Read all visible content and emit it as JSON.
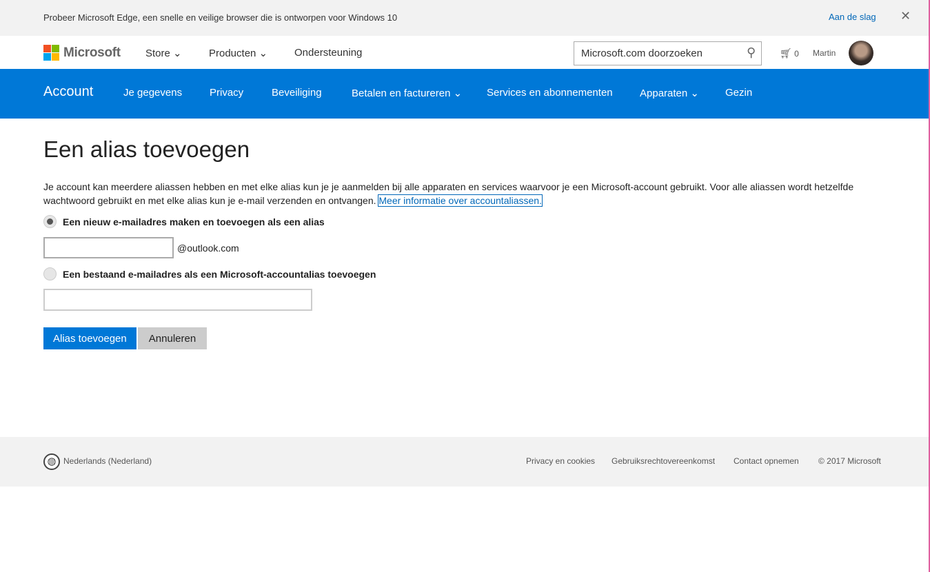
{
  "banner": {
    "text": "Probeer Microsoft Edge, een snelle en veilige browser die is ontworpen voor Windows 10",
    "link": "Aan de slag",
    "close": "✕"
  },
  "header": {
    "brand": "Microsoft",
    "nav": [
      "Store ⌄",
      "Producten ⌄",
      "Ondersteuning"
    ],
    "search_placeholder": "Microsoft.com doorzoeken",
    "cart_count": "0",
    "user": "Martin"
  },
  "account_nav": {
    "title": "Account",
    "items": [
      "Je gegevens",
      "Privacy",
      "Beveiliging",
      "Betalen en factureren ⌄",
      "Services en abonnementen",
      "Apparaten ⌄",
      "Gezin"
    ]
  },
  "main": {
    "title": "Een alias toevoegen",
    "description": "Je account kan meerdere aliassen hebben en met elke alias kun je je aanmelden bij alle apparaten en services waarvoor je een Microsoft-account gebruikt. Voor alle aliassen wordt hetzelfde wachtwoord gebruikt en met elke alias kun je e-mail verzenden en ontvangen. ",
    "learn_more": "Meer informatie over accountaliassen.",
    "option_new": "Een nieuw e-mailadres maken en toevoegen als een alias",
    "domain_suffix": "@outlook.com",
    "option_existing": "Een bestaand e-mailadres als een Microsoft-accountalias toevoegen",
    "submit": "Alias toevoegen",
    "cancel": "Annuleren"
  },
  "footer": {
    "language": "Nederlands (Nederland)",
    "links": [
      "Privacy en cookies",
      "Gebruiksrechtovereenkomst",
      "Contact opnemen",
      "© 2017 Microsoft"
    ]
  }
}
